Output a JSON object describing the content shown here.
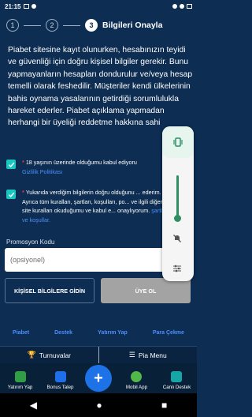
{
  "status": {
    "time": "21:15"
  },
  "steps": {
    "step1": "1",
    "step2": "2",
    "step3": "3",
    "title": "Bilgileri Onayla"
  },
  "intro": {
    "text": "Piabet sitesine kayıt olunurken, hesabınızın teyidi ve güvenliği için doğru kişisel bilgiler gerekir. Bunu yapmayanların hesapları dondurulur ve/veya hesap temelli olarak feshedilir. Müşteriler kendi ülkelerinin bahis oynama yasalarının getirdiği sorumlulukla hareket ederler. Piabet açıklama yapmadan herhangi bir üyeliği reddetme hakkına sahi"
  },
  "checks": {
    "age_text": "18 yaşının üzerinde olduğumu kabul ediyoru",
    "age_link": "Gizlilik Politikası",
    "terms_text": "Yukarıda verdiğim bilgilerin doğru olduğunu ... ederim. Ayrıca tüm kuralları, şartları, koşulları, po... ve ilgili diğer site kuralları okuduğumu ve kabul e... onaylıyorum.",
    "terms_link": "şartlar ve koşullar."
  },
  "promo": {
    "label": "Promosyon Kodu",
    "placeholder": "(opsiyonel)"
  },
  "buttons": {
    "back": "KİŞİSEL BİLGİLERE GİDİN",
    "signup": "ÜYE OL"
  },
  "footer_links": [
    "Piabet",
    "Destek",
    "Yatırım Yap",
    "Para Çekme"
  ],
  "menu": {
    "tournaments": "Turnuvalar",
    "pia_menu": "Pia Menu"
  },
  "tabs": [
    {
      "label": "Yatırım Yap",
      "color": "#2f9e44"
    },
    {
      "label": "Bonus Talep",
      "color": "#1f6feb"
    },
    {
      "label": "Mobil App",
      "color": "#52b849"
    },
    {
      "label": "Canlı Destek",
      "color": "#16a6a6"
    }
  ],
  "fab": {
    "label": "+"
  },
  "nav": {
    "back": "◀",
    "home": "●",
    "recent": "■"
  },
  "colors": {
    "accent": "#17c7c0",
    "link": "#4b8fff",
    "required": "#e2384d",
    "background": "#0d2d52"
  }
}
